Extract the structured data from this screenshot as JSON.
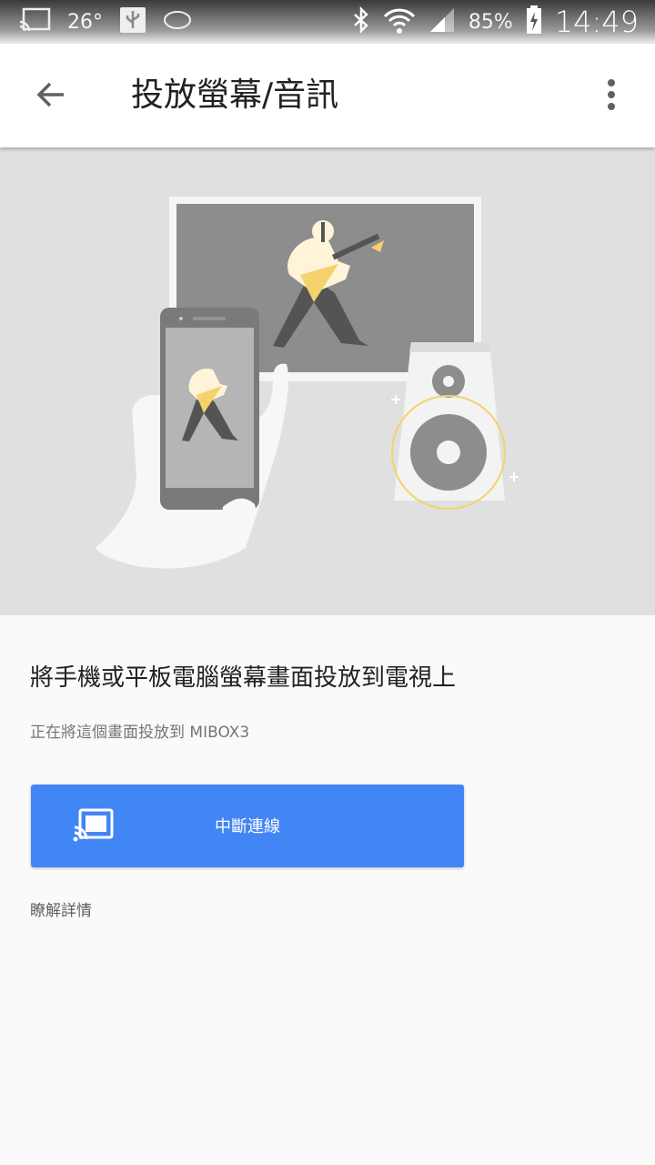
{
  "status_bar": {
    "temperature": "26°",
    "battery": "85%",
    "clock": "14:49",
    "icons": [
      "cast-icon",
      "usb-icon",
      "app-notification-icon",
      "bluetooth-icon",
      "wifi-icon",
      "signal-icon",
      "battery-charging-icon"
    ]
  },
  "app_bar": {
    "title": "投放螢幕/音訊",
    "back_icon": "arrow-back-icon",
    "menu_icon": "more-vert-icon"
  },
  "main": {
    "headline": "將手機或平板電腦螢幕畫面投放到電視上",
    "subtext": "正在將這個畫面投放到 MIBOX3",
    "disconnect_label": "中斷連線",
    "learn_more": "瞭解詳情"
  },
  "colors": {
    "accent": "#4285f4",
    "hero_bg": "#e0e0e0",
    "guitar": "#f5d26b"
  }
}
